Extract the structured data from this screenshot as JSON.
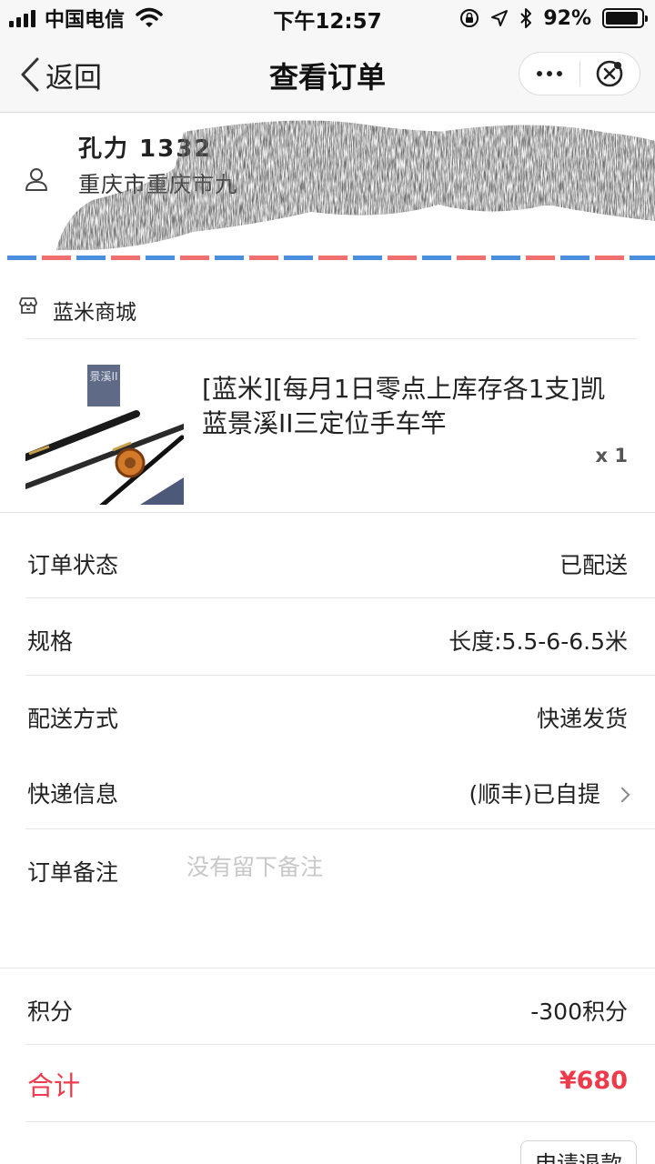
{
  "status_bar": {
    "carrier": "中国电信",
    "time": "下午12:57",
    "battery_percent": "92%",
    "battery_level": 0.92
  },
  "nav": {
    "back_label": "返回",
    "title": "查看订单",
    "more_icon": "more-dots-icon",
    "close_icon": "close-circle-icon"
  },
  "address": {
    "name": "孔力 1332",
    "line": "重庆市重庆市九",
    "icon": "person-icon"
  },
  "shop": {
    "name": "蓝米商城",
    "icon": "store-icon"
  },
  "product": {
    "title": "[蓝米][每月1日零点上库存各1支]凯蓝景溪II三定位手车竿",
    "qty": "x 1",
    "image_caption": "景溪II"
  },
  "rows": {
    "status": {
      "label": "订单状态",
      "value": "已配送"
    },
    "spec": {
      "label": "规格",
      "value": "长度:5.5-6-6.5米"
    },
    "delivery": {
      "label": "配送方式",
      "value": "快递发货"
    },
    "express": {
      "label": "快递信息",
      "value": "(顺丰)已自提"
    },
    "note": {
      "label": "订单备注",
      "placeholder": "没有留下备注"
    },
    "points": {
      "label": "积分",
      "value": "-300积分"
    },
    "total": {
      "label": "合计",
      "value": "¥680"
    }
  },
  "refund_button": "申请退款",
  "colors": {
    "accent_red": "#ee3a4b",
    "airmail_blue": "#4a8ee0",
    "airmail_red": "#f07070"
  }
}
